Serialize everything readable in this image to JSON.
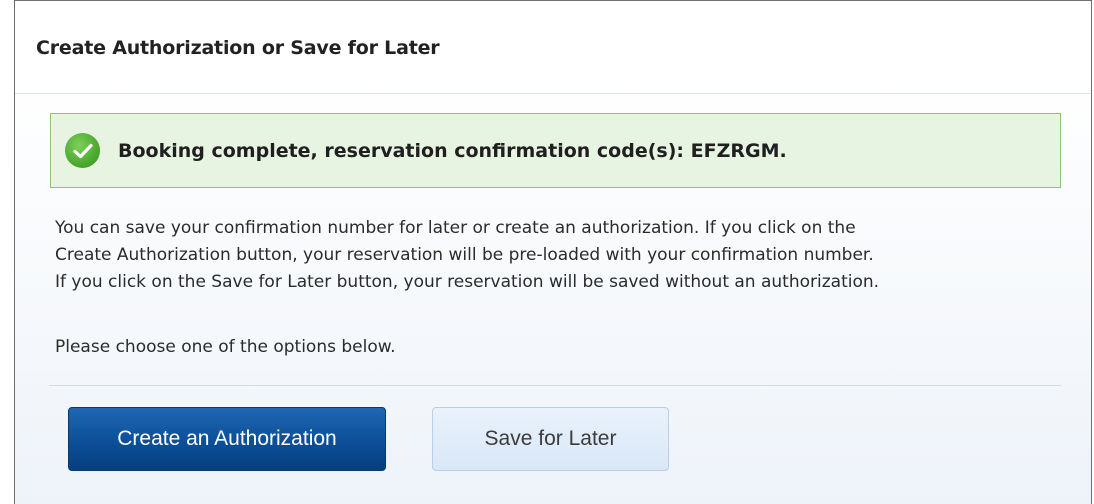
{
  "panel": {
    "title": "Create Authorization or Save for Later"
  },
  "alert": {
    "icon": "checkmark-success-icon",
    "message": "Booking complete, reservation confirmation code(s): EFZRGM.",
    "colors": {
      "background": "#e8f4e2",
      "border": "#8fc27c",
      "icon": "#4caa2f"
    }
  },
  "body": {
    "line1": "You can save your confirmation number for later or create an authorization. If you click on the",
    "line2": "Create Authorization button, your reservation will be pre-loaded with your confirmation number.",
    "line3": "If you click on the Save for Later button, your reservation will be saved without an authorization.",
    "prompt": "Please choose one of the options below."
  },
  "buttons": {
    "create_label": "Create an Authorization",
    "save_label": "Save for Later"
  },
  "colors": {
    "primary_button": "#0c4f98",
    "secondary_button": "#d9e7f7"
  }
}
